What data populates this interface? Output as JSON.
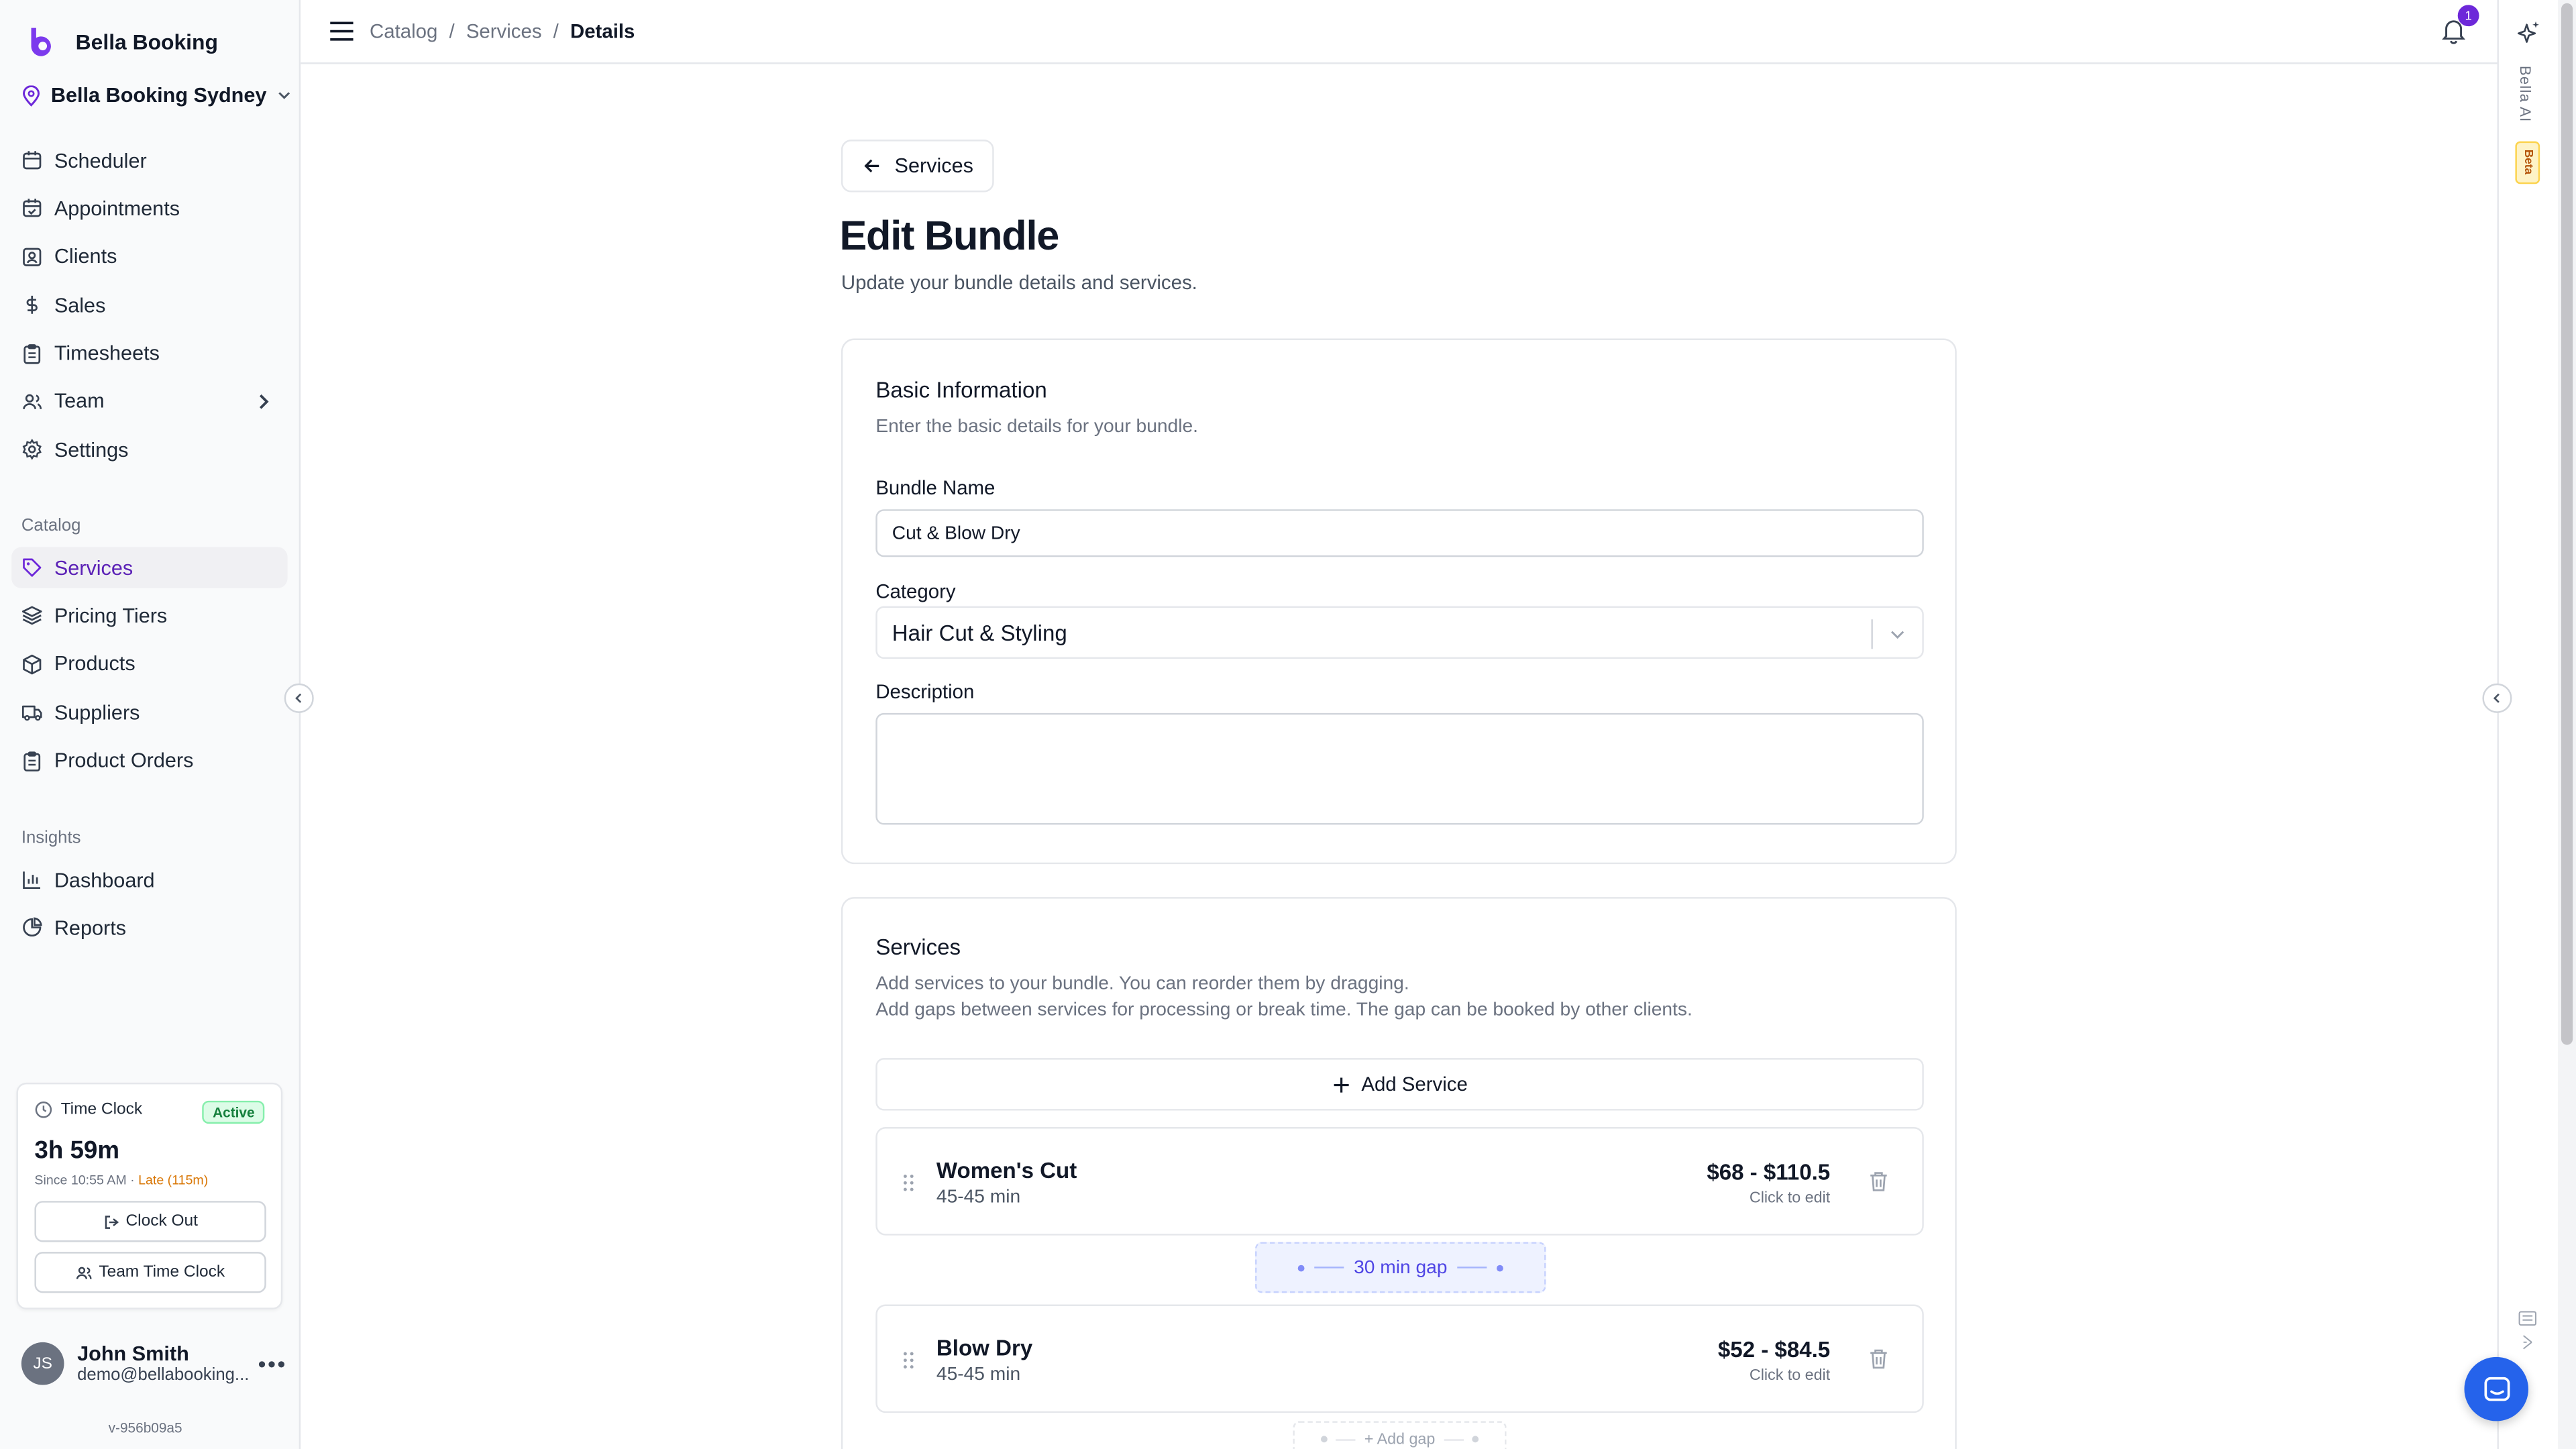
{
  "app": {
    "name": "Bella Booking",
    "location": "Bella Booking Sydney",
    "version": "v-956b09a5"
  },
  "nav": {
    "main": [
      {
        "label": "Scheduler",
        "icon": "calendar-icon"
      },
      {
        "label": "Appointments",
        "icon": "calendar-check-icon"
      },
      {
        "label": "Clients",
        "icon": "contact-icon"
      },
      {
        "label": "Sales",
        "icon": "dollar-icon"
      },
      {
        "label": "Timesheets",
        "icon": "clipboard-icon"
      },
      {
        "label": "Team",
        "icon": "users-icon"
      },
      {
        "label": "Settings",
        "icon": "gear-icon"
      }
    ],
    "catalog_label": "Catalog",
    "catalog": [
      {
        "label": "Services",
        "icon": "tag-icon",
        "active": true
      },
      {
        "label": "Pricing Tiers",
        "icon": "layers-icon"
      },
      {
        "label": "Products",
        "icon": "package-icon"
      },
      {
        "label": "Suppliers",
        "icon": "truck-icon"
      },
      {
        "label": "Product Orders",
        "icon": "clipboard-list-icon"
      }
    ],
    "insights_label": "Insights",
    "insights": [
      {
        "label": "Dashboard",
        "icon": "bar-chart-icon"
      },
      {
        "label": "Reports",
        "icon": "pie-chart-icon"
      }
    ]
  },
  "timeclock": {
    "title": "Time Clock",
    "status": "Active",
    "elapsed": "3h 59m",
    "since": "Since 10:55 AM · ",
    "late": "Late (115m)",
    "clock_out_label": "Clock Out",
    "team_label": "Team Time Clock"
  },
  "user": {
    "initials": "JS",
    "name": "John Smith",
    "email": "demo@bellabooking..."
  },
  "header": {
    "breadcrumb": [
      "Catalog",
      "Services",
      "Details"
    ],
    "notifications": "1"
  },
  "ai": {
    "label": "Bella AI",
    "badge": "Beta"
  },
  "page": {
    "back_label": "Services",
    "title": "Edit Bundle",
    "subtitle": "Update your bundle details and services."
  },
  "basic": {
    "title": "Basic Information",
    "desc": "Enter the basic details for your bundle.",
    "name_label": "Bundle Name",
    "name_value": "Cut & Blow Dry",
    "category_label": "Category",
    "category_value": "Hair Cut & Styling",
    "description_label": "Description",
    "description_value": ""
  },
  "services": {
    "title": "Services",
    "desc_1": "Add services to your bundle. You can reorder them by dragging.",
    "desc_2": "Add gaps between services for processing or break time. The gap can be booked by other clients.",
    "add_label": "Add Service",
    "items": [
      {
        "name": "Women's Cut",
        "duration": "45-45 min",
        "price": "$68 - $110.5",
        "edit": "Click to edit"
      },
      {
        "name": "Blow Dry",
        "duration": "45-45 min",
        "price": "$52 - $84.5",
        "edit": "Click to edit"
      }
    ],
    "gap_label": "30 min gap",
    "add_gap_label": "+ Add gap"
  },
  "colors": {
    "accent": "#6d28d9",
    "brand": "#7c3aed",
    "chat": "#2563eb"
  }
}
